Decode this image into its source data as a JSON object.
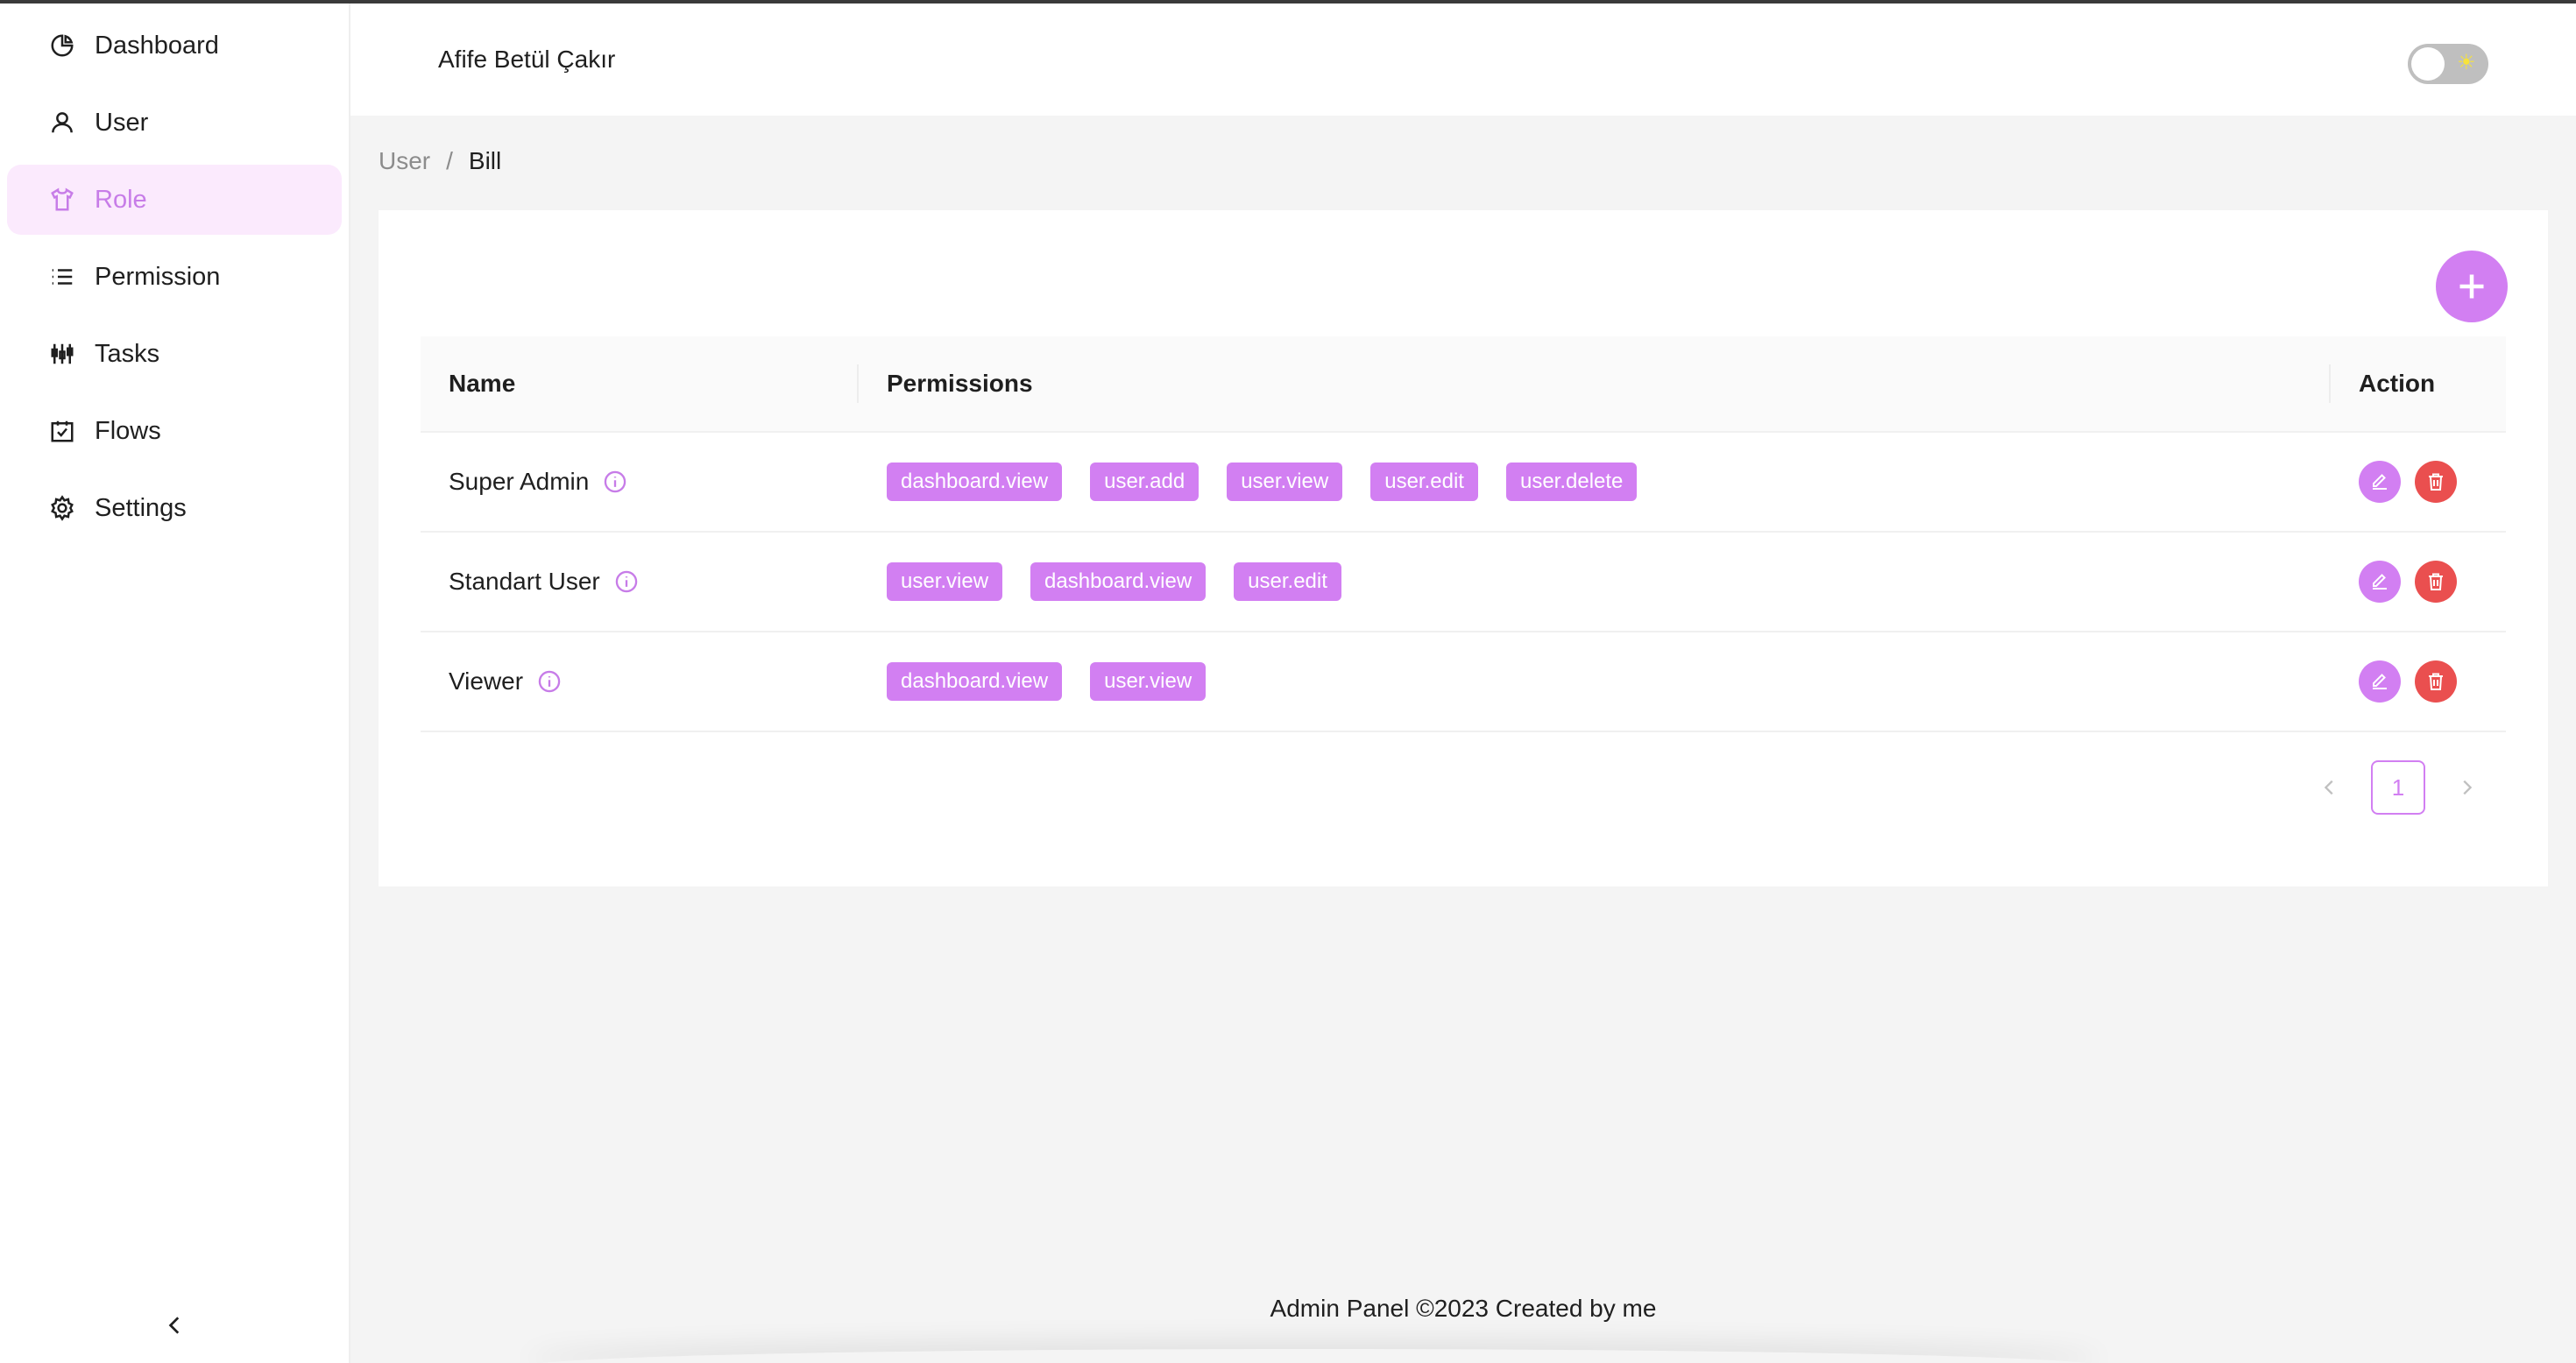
{
  "sidebar": {
    "items": [
      {
        "label": "Dashboard",
        "icon": "pie-chart-icon"
      },
      {
        "label": "User",
        "icon": "user-icon"
      },
      {
        "label": "Role",
        "icon": "shirt-icon",
        "active": true
      },
      {
        "label": "Permission",
        "icon": "list-icon"
      },
      {
        "label": "Tasks",
        "icon": "sliders-icon"
      },
      {
        "label": "Flows",
        "icon": "calendar-check-icon"
      },
      {
        "label": "Settings",
        "icon": "gear-icon"
      }
    ],
    "collapse_icon": "chevron-left-icon"
  },
  "header": {
    "user_name": "Afife Betül Çakır",
    "theme_toggle": {
      "state": "off",
      "icon": "sun-icon"
    }
  },
  "breadcrumb": {
    "items": [
      "User",
      "Bill"
    ],
    "separator": "/"
  },
  "table": {
    "columns": [
      "Name",
      "Permissions",
      "Action"
    ],
    "rows": [
      {
        "name": "Super Admin",
        "permissions": [
          "dashboard.view",
          "user.add",
          "user.view",
          "user.edit",
          "user.delete"
        ]
      },
      {
        "name": "Standart User",
        "permissions": [
          "user.view",
          "dashboard.view",
          "user.edit"
        ]
      },
      {
        "name": "Viewer",
        "permissions": [
          "dashboard.view",
          "user.view"
        ]
      }
    ]
  },
  "pagination": {
    "current_page": "1"
  },
  "footer": {
    "text": "Admin Panel ©2023 Created by me"
  },
  "colors": {
    "accent": "#d27ff2",
    "danger": "#ea4f4f",
    "active_bg": "#fbeafd"
  }
}
